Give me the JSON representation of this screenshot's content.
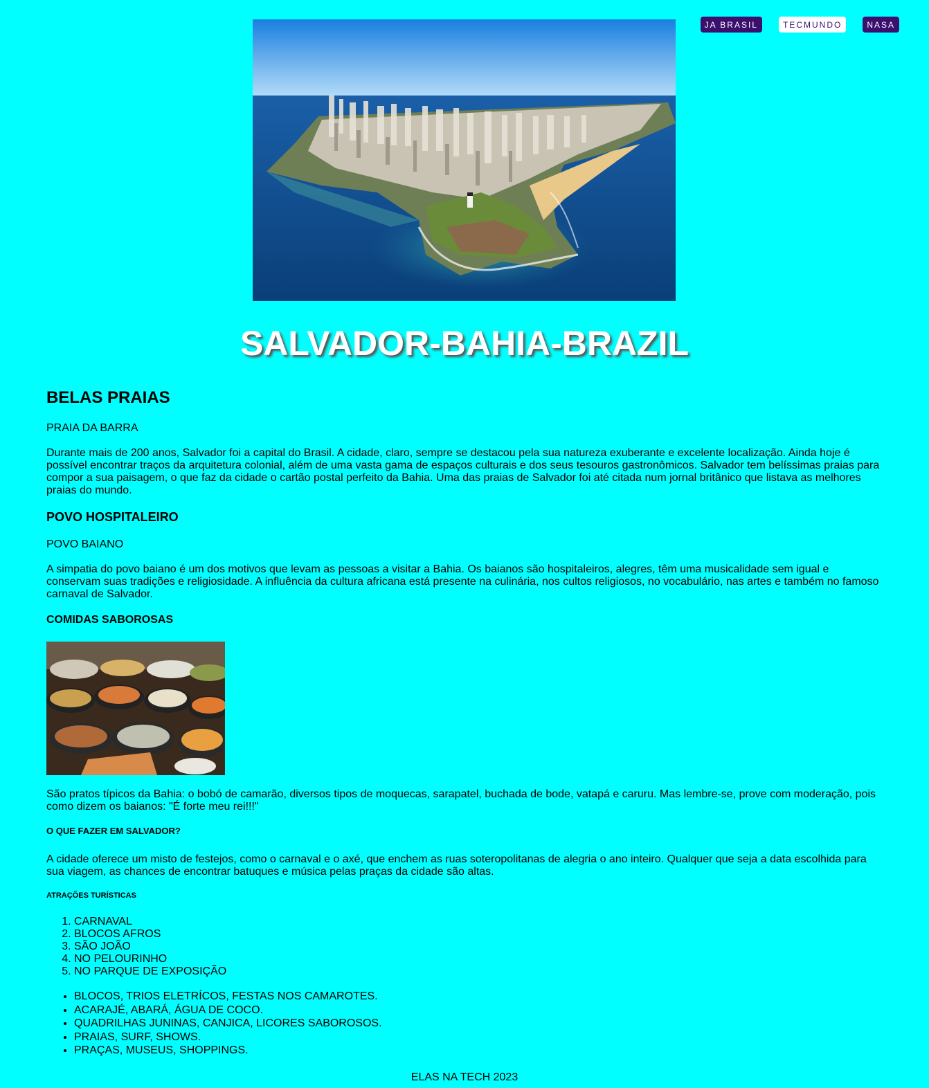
{
  "nav": {
    "links": [
      {
        "label": "JA BRASIL"
      },
      {
        "label": "TECMUNDO"
      },
      {
        "label": "NASA"
      }
    ]
  },
  "header": {
    "title": "SALVADOR-BAHIA-BRAZIL"
  },
  "sections": {
    "praias": {
      "heading": "BELAS PRAIAS",
      "subheading": "PRAIA DA BARRA",
      "text": "Durante mais de 200 anos, Salvador foi a capital do Brasil. A cidade, claro, sempre se destacou pela sua natureza exuberante e excelente localização. Ainda hoje é possível encontrar traços da arquitetura colonial, além de uma vasta gama de espaços culturais e dos seus tesouros gastronômicos. Salvador tem belíssimas praias para compor a sua paisagem, o que faz da cidade o cartão postal perfeito da Bahia. Uma das praias de Salvador foi até citada num jornal britânico que listava as melhores praias do mundo."
    },
    "povo": {
      "heading": "POVO HOSPITALEIRO",
      "subheading": "POVO BAIANO",
      "text": "A simpatia do povo baiano é um dos motivos que levam as pessoas a visitar a Bahia. Os baianos são hospitaleiros, alegres, têm uma musicalidade sem igual e conservam suas tradições e religiosidade. A influência da cultura africana está presente na culinária, nos cultos religiosos, no vocabulário, nas artes e também no famoso carnaval de Salvador."
    },
    "comidas": {
      "heading": "COMIDAS SABOROSAS",
      "text": "São pratos típicos da Bahia: o bobó de camarão, diversos tipos de moquecas, sarapatel, buchada de bode, vatapá e caruru. Mas lembre-se, prove com moderação, pois como dizem os baianos: \"É forte meu rei!!!\""
    },
    "fazer": {
      "heading": "O QUE FAZER EM SALVADOR?",
      "text": "A cidade oferece um misto de festejos, como o carnaval e o axé, que enchem as ruas soteropolitanas de alegria o ano inteiro. Qualquer que seja a data escolhida para sua viagem, as chances de encontrar batuques e música pelas praças da cidade são altas."
    },
    "atracoes": {
      "heading": "ATRAÇÕES TURÍSTICAS",
      "ordered": [
        "CARNAVAL",
        "BLOCOS AFROS",
        "SÃO JOÃO",
        "NO PELOURINHO",
        "NO PARQUE DE EXPOSIÇÃO"
      ],
      "unordered": [
        "BLOCOS, TRIOS ELETRÍCOS, FESTAS NOS CAMAROTES.",
        "ACARAJÉ, ABARÁ, ÁGUA DE COCO.",
        "QUADRILHAS JUNINAS, CANJICA, LICORES SABOROSOS.",
        "PRAIAS, SURF, SHOWS.",
        "PRAÇAS, MUSEUS, SHOPPINGS."
      ]
    }
  },
  "footer": {
    "text": "ELAS NA TECH 2023"
  },
  "colors": {
    "background": "#00ffff",
    "nav_dark": "#3b0f6e",
    "nav_light": "#ffffff",
    "title": "#ffffff"
  }
}
